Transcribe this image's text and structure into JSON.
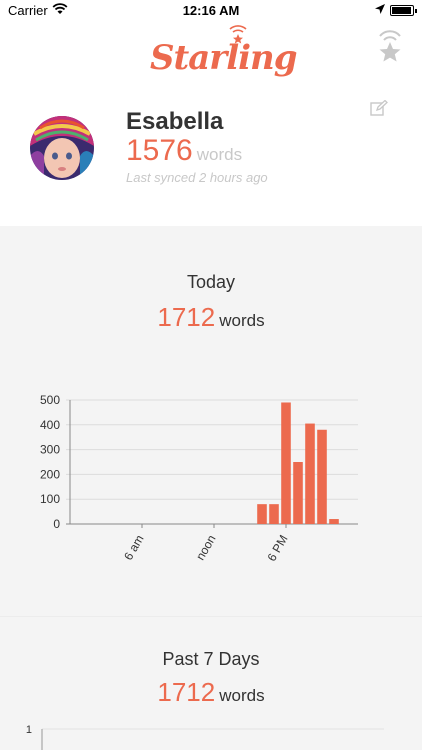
{
  "status_bar": {
    "carrier": "Carrier",
    "time": "12:16 AM"
  },
  "app": {
    "logo_text": "Starling"
  },
  "profile": {
    "name": "Esabella",
    "word_count": "1576",
    "word_unit": "words",
    "last_synced": "Last synced 2 hours ago"
  },
  "today": {
    "title": "Today",
    "count": "1712",
    "unit": "words"
  },
  "past7": {
    "title": "Past 7 Days",
    "count": "1712",
    "unit": "words",
    "y_tick_top": "1"
  },
  "colors": {
    "accent": "#ec6a4e",
    "muted": "#c8c8c8",
    "background": "#f4f4f4"
  },
  "chart_data": {
    "type": "bar",
    "title": "",
    "xlabel": "",
    "ylabel": "",
    "ylim": [
      0,
      500
    ],
    "yticks": [
      "0",
      "100",
      "200",
      "300",
      "400",
      "500"
    ],
    "xticks": [
      {
        "hour": 6,
        "label": "6 am"
      },
      {
        "hour": 12,
        "label": "noon"
      },
      {
        "hour": 18,
        "label": "6 PM"
      }
    ],
    "x_range": [
      0,
      24
    ],
    "bars": [
      {
        "hour": 16,
        "value": 80
      },
      {
        "hour": 17,
        "value": 80
      },
      {
        "hour": 18,
        "value": 490
      },
      {
        "hour": 19,
        "value": 250
      },
      {
        "hour": 20,
        "value": 405
      },
      {
        "hour": 21,
        "value": 380
      },
      {
        "hour": 22,
        "value": 20
      }
    ],
    "grid": true
  }
}
